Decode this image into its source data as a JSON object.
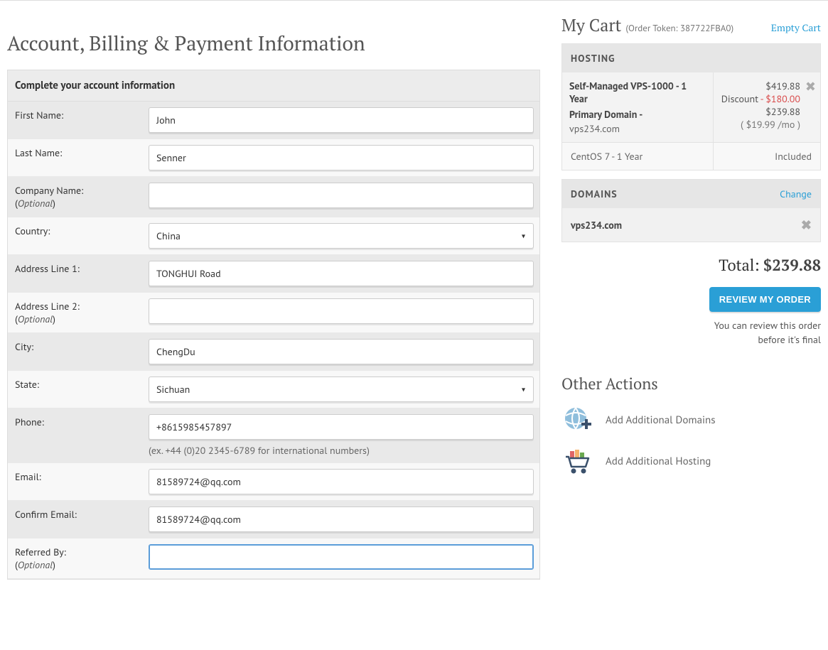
{
  "page": {
    "title": "Account, Billing & Payment Information"
  },
  "form": {
    "header": "Complete your account information",
    "first_name": {
      "label": "First Name:",
      "value": "John"
    },
    "last_name": {
      "label": "Last Name:",
      "value": "Senner"
    },
    "company": {
      "label": "Company Name:",
      "optional": "Optional",
      "value": ""
    },
    "country": {
      "label": "Country:",
      "value": "China"
    },
    "address1": {
      "label": "Address Line 1:",
      "value": "TONGHUI Road"
    },
    "address2": {
      "label": "Address Line 2:",
      "optional": "Optional",
      "value": ""
    },
    "city": {
      "label": "City:",
      "value": "ChengDu"
    },
    "state": {
      "label": "State:",
      "value": "Sichuan"
    },
    "phone": {
      "label": "Phone:",
      "value": "+8615985457897",
      "hint": "(ex. +44 (0)20 2345-6789 for international numbers)"
    },
    "email": {
      "label": "Email:",
      "value": "81589724@qq.com"
    },
    "confirm_email": {
      "label": "Confirm Email:",
      "value": "81589724@qq.com"
    },
    "referred_by": {
      "label": "Referred By:",
      "optional": "Optional",
      "value": ""
    }
  },
  "cart": {
    "title": "My Cart",
    "token_label": "(Order Token: 387722FBA0)",
    "empty_label": "Empty Cart",
    "hosting_header": "HOSTING",
    "hosting_item": {
      "name": "Self-Managed VPS-1000 - 1 Year",
      "primary_domain_label": "Primary Domain -",
      "primary_domain_value": "vps234.com",
      "price_original": "$419.88",
      "discount_label": "Discount",
      "discount_value": "- $180.00",
      "price_now": "$239.88",
      "per_month": "( $19.99 /mo )",
      "addon_name": "CentOS 7 - 1 Year",
      "addon_price": "Included"
    },
    "domains_header": "DOMAINS",
    "domains_change": "Change",
    "domain_value": "vps234.com",
    "total_label": "Total:",
    "total_value": "$239.88",
    "review_button": "REVIEW MY ORDER",
    "review_hint_1": "You can review this order",
    "review_hint_2": "before it's final"
  },
  "other_actions": {
    "title": "Other Actions",
    "add_domains": "Add Additional Domains",
    "add_hosting": "Add Additional Hosting"
  }
}
